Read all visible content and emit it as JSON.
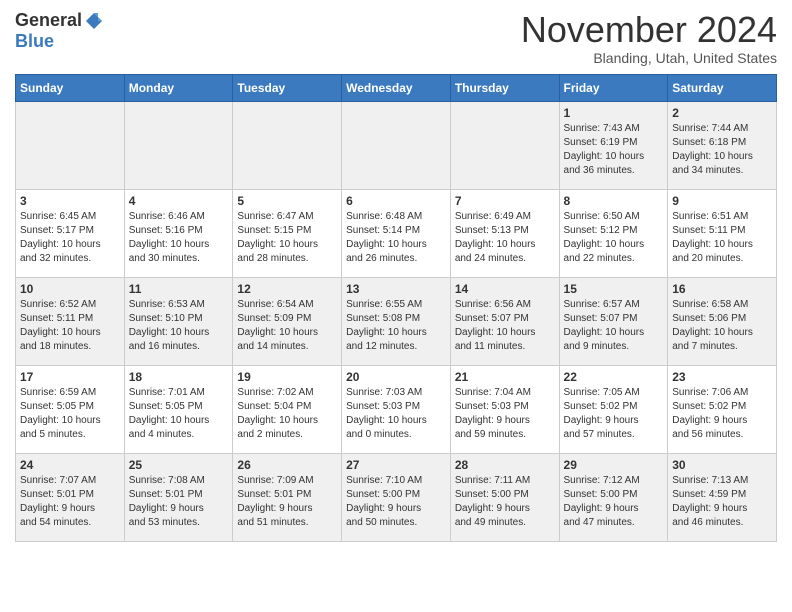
{
  "header": {
    "logo_general": "General",
    "logo_blue": "Blue",
    "month_title": "November 2024",
    "location": "Blanding, Utah, United States"
  },
  "weekdays": [
    "Sunday",
    "Monday",
    "Tuesday",
    "Wednesday",
    "Thursday",
    "Friday",
    "Saturday"
  ],
  "weeks": [
    [
      {
        "day": "",
        "info": ""
      },
      {
        "day": "",
        "info": ""
      },
      {
        "day": "",
        "info": ""
      },
      {
        "day": "",
        "info": ""
      },
      {
        "day": "",
        "info": ""
      },
      {
        "day": "1",
        "info": "Sunrise: 7:43 AM\nSunset: 6:19 PM\nDaylight: 10 hours\nand 36 minutes."
      },
      {
        "day": "2",
        "info": "Sunrise: 7:44 AM\nSunset: 6:18 PM\nDaylight: 10 hours\nand 34 minutes."
      }
    ],
    [
      {
        "day": "3",
        "info": "Sunrise: 6:45 AM\nSunset: 5:17 PM\nDaylight: 10 hours\nand 32 minutes."
      },
      {
        "day": "4",
        "info": "Sunrise: 6:46 AM\nSunset: 5:16 PM\nDaylight: 10 hours\nand 30 minutes."
      },
      {
        "day": "5",
        "info": "Sunrise: 6:47 AM\nSunset: 5:15 PM\nDaylight: 10 hours\nand 28 minutes."
      },
      {
        "day": "6",
        "info": "Sunrise: 6:48 AM\nSunset: 5:14 PM\nDaylight: 10 hours\nand 26 minutes."
      },
      {
        "day": "7",
        "info": "Sunrise: 6:49 AM\nSunset: 5:13 PM\nDaylight: 10 hours\nand 24 minutes."
      },
      {
        "day": "8",
        "info": "Sunrise: 6:50 AM\nSunset: 5:12 PM\nDaylight: 10 hours\nand 22 minutes."
      },
      {
        "day": "9",
        "info": "Sunrise: 6:51 AM\nSunset: 5:11 PM\nDaylight: 10 hours\nand 20 minutes."
      }
    ],
    [
      {
        "day": "10",
        "info": "Sunrise: 6:52 AM\nSunset: 5:11 PM\nDaylight: 10 hours\nand 18 minutes."
      },
      {
        "day": "11",
        "info": "Sunrise: 6:53 AM\nSunset: 5:10 PM\nDaylight: 10 hours\nand 16 minutes."
      },
      {
        "day": "12",
        "info": "Sunrise: 6:54 AM\nSunset: 5:09 PM\nDaylight: 10 hours\nand 14 minutes."
      },
      {
        "day": "13",
        "info": "Sunrise: 6:55 AM\nSunset: 5:08 PM\nDaylight: 10 hours\nand 12 minutes."
      },
      {
        "day": "14",
        "info": "Sunrise: 6:56 AM\nSunset: 5:07 PM\nDaylight: 10 hours\nand 11 minutes."
      },
      {
        "day": "15",
        "info": "Sunrise: 6:57 AM\nSunset: 5:07 PM\nDaylight: 10 hours\nand 9 minutes."
      },
      {
        "day": "16",
        "info": "Sunrise: 6:58 AM\nSunset: 5:06 PM\nDaylight: 10 hours\nand 7 minutes."
      }
    ],
    [
      {
        "day": "17",
        "info": "Sunrise: 6:59 AM\nSunset: 5:05 PM\nDaylight: 10 hours\nand 5 minutes."
      },
      {
        "day": "18",
        "info": "Sunrise: 7:01 AM\nSunset: 5:05 PM\nDaylight: 10 hours\nand 4 minutes."
      },
      {
        "day": "19",
        "info": "Sunrise: 7:02 AM\nSunset: 5:04 PM\nDaylight: 10 hours\nand 2 minutes."
      },
      {
        "day": "20",
        "info": "Sunrise: 7:03 AM\nSunset: 5:03 PM\nDaylight: 10 hours\nand 0 minutes."
      },
      {
        "day": "21",
        "info": "Sunrise: 7:04 AM\nSunset: 5:03 PM\nDaylight: 9 hours\nand 59 minutes."
      },
      {
        "day": "22",
        "info": "Sunrise: 7:05 AM\nSunset: 5:02 PM\nDaylight: 9 hours\nand 57 minutes."
      },
      {
        "day": "23",
        "info": "Sunrise: 7:06 AM\nSunset: 5:02 PM\nDaylight: 9 hours\nand 56 minutes."
      }
    ],
    [
      {
        "day": "24",
        "info": "Sunrise: 7:07 AM\nSunset: 5:01 PM\nDaylight: 9 hours\nand 54 minutes."
      },
      {
        "day": "25",
        "info": "Sunrise: 7:08 AM\nSunset: 5:01 PM\nDaylight: 9 hours\nand 53 minutes."
      },
      {
        "day": "26",
        "info": "Sunrise: 7:09 AM\nSunset: 5:01 PM\nDaylight: 9 hours\nand 51 minutes."
      },
      {
        "day": "27",
        "info": "Sunrise: 7:10 AM\nSunset: 5:00 PM\nDaylight: 9 hours\nand 50 minutes."
      },
      {
        "day": "28",
        "info": "Sunrise: 7:11 AM\nSunset: 5:00 PM\nDaylight: 9 hours\nand 49 minutes."
      },
      {
        "day": "29",
        "info": "Sunrise: 7:12 AM\nSunset: 5:00 PM\nDaylight: 9 hours\nand 47 minutes."
      },
      {
        "day": "30",
        "info": "Sunrise: 7:13 AM\nSunset: 4:59 PM\nDaylight: 9 hours\nand 46 minutes."
      }
    ]
  ]
}
